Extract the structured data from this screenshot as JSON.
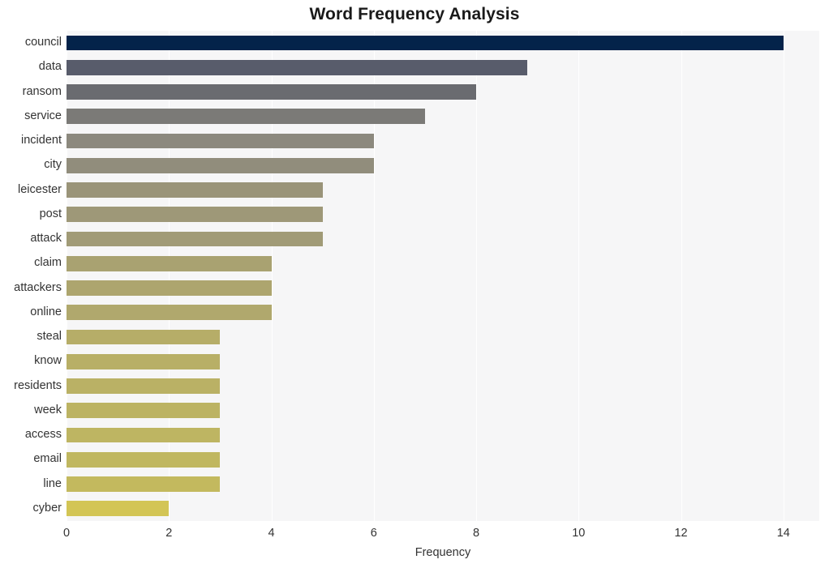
{
  "chart_data": {
    "type": "bar",
    "orientation": "horizontal",
    "title": "Word Frequency Analysis",
    "xlabel": "Frequency",
    "ylabel": "",
    "xlim": [
      0,
      14.7
    ],
    "ylim": null,
    "grid": true,
    "legend": false,
    "xticks": [
      0,
      2,
      4,
      6,
      8,
      10,
      12,
      14
    ],
    "xtick_labels": [
      "0",
      "2",
      "4",
      "6",
      "8",
      "10",
      "12",
      "14"
    ],
    "categories": [
      "council",
      "data",
      "ransom",
      "service",
      "incident",
      "city",
      "leicester",
      "post",
      "attack",
      "claim",
      "attackers",
      "online",
      "steal",
      "know",
      "residents",
      "week",
      "access",
      "email",
      "line",
      "cyber"
    ],
    "values": [
      14,
      9,
      8,
      7,
      6,
      6,
      5,
      5,
      5,
      4,
      4,
      4,
      3,
      3,
      3,
      3,
      3,
      3,
      3,
      2
    ],
    "bar_colors": [
      "#04234a",
      "#585c6b",
      "#6a6b70",
      "#7b7a77",
      "#8c897e",
      "#918d7c",
      "#9a9479",
      "#9e9878",
      "#a19b77",
      "#a9a271",
      "#ada56e",
      "#b0a86d",
      "#b6ad68",
      "#b8af66",
      "#bab165",
      "#bcb363",
      "#beb562",
      "#c0b760",
      "#c3b95e",
      "#d3c555"
    ],
    "plot_background": "#f6f6f7",
    "figure_background": "#ffffff",
    "gridline_color": "#ffffff",
    "text_color": "#333333"
  }
}
